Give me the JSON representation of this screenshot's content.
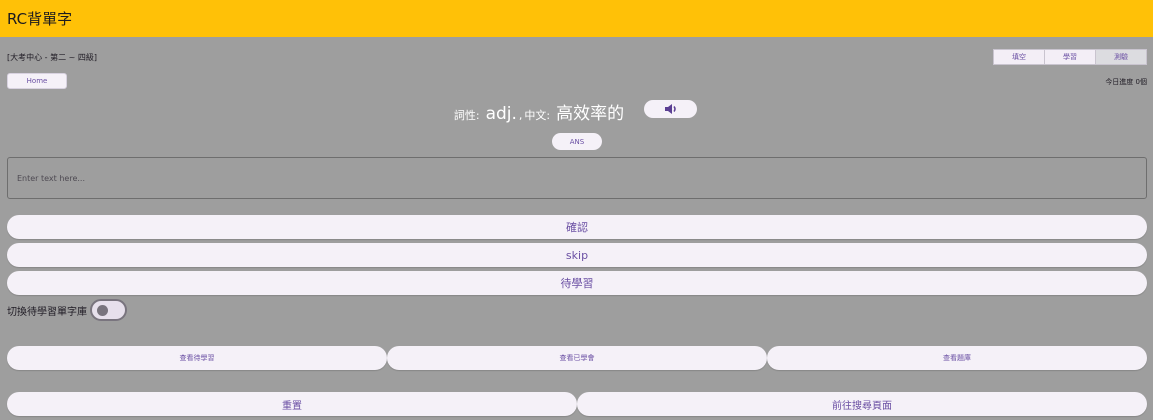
{
  "app": {
    "title": "RC背單字"
  },
  "breadcrumb": "[大考中心 - 第二 ~ 四級]",
  "mode_tabs": [
    {
      "label": "填空",
      "active": false
    },
    {
      "label": "學習",
      "active": false
    },
    {
      "label": "測驗",
      "active": true
    }
  ],
  "home_label": "Home",
  "progress_text": "今日進度 0個",
  "word": {
    "pos_label": "詞性:",
    "pos_value": "adj.",
    "separator": ",",
    "chinese_label": "中文:",
    "chinese_value": "高效率的"
  },
  "speaker_icon": "volume-icon",
  "ans_label": "ANS",
  "input": {
    "placeholder": "Enter text here...",
    "value": ""
  },
  "actions": {
    "confirm": "確認",
    "skip": "skip",
    "pending": "待學習"
  },
  "toggle": {
    "label": "切換待學習單字庫",
    "on": false
  },
  "view_buttons": [
    "查看待學習",
    "查看已學會",
    "查看題庫"
  ],
  "bottom_buttons": {
    "reset": "重置",
    "search": "前往搜尋頁面"
  },
  "colors": {
    "appbar": "#ffc107",
    "background": "#9e9e9e",
    "accent": "#6a4fa3",
    "button": "#f5f1f8"
  }
}
